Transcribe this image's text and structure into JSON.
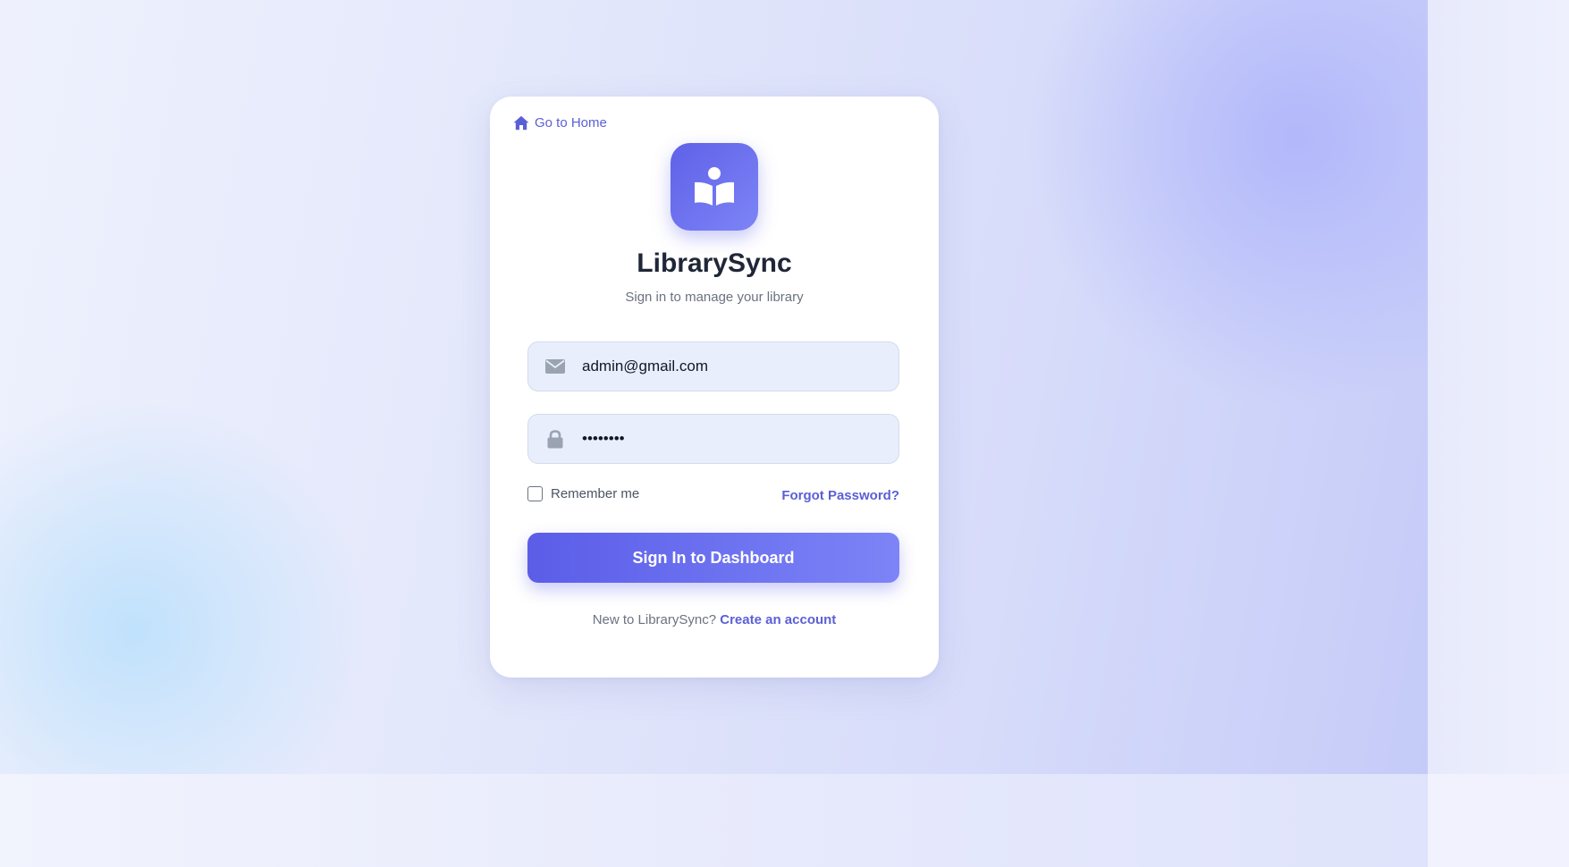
{
  "header": {
    "home_link_label": "Go to Home"
  },
  "brand": {
    "app_name": "LibrarySync",
    "subtitle": "Sign in to manage your library",
    "logo_icon": "book-reader-icon",
    "accent_color": "#5b5fd6"
  },
  "form": {
    "email": {
      "value": "admin@gmail.com",
      "icon": "envelope-icon"
    },
    "password": {
      "value": "••••••••",
      "icon": "lock-icon"
    },
    "remember_label": "Remember me",
    "remember_checked": false,
    "forgot_label": "Forgot Password?",
    "submit_label": "Sign In to Dashboard"
  },
  "footer": {
    "prompt": "New to LibrarySync?",
    "link_label": "Create an account"
  }
}
